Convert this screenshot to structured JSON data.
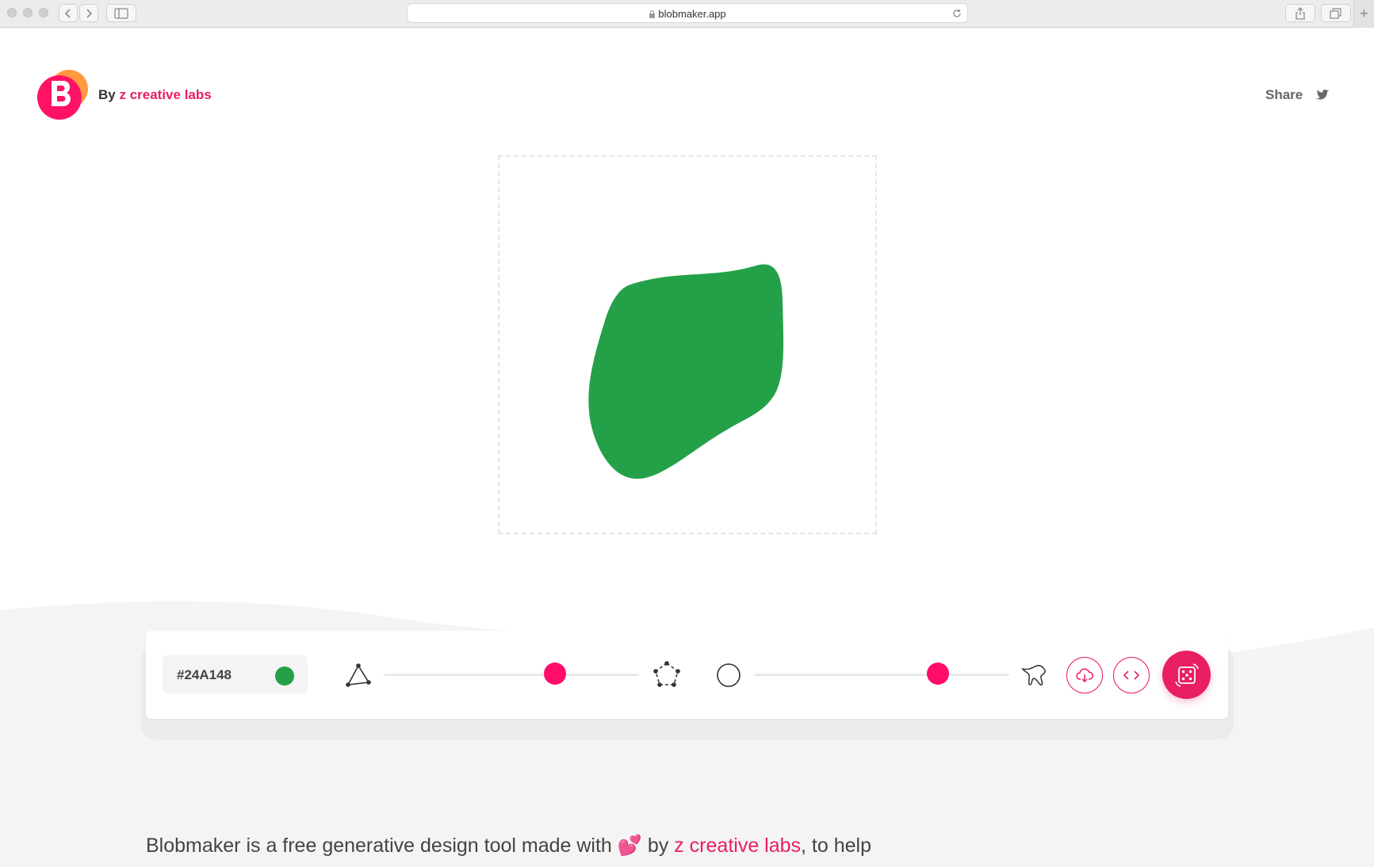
{
  "browser": {
    "url": "blobmaker.app"
  },
  "header": {
    "by_label": "By",
    "brand_name": "z creative labs",
    "share_label": "Share"
  },
  "controls": {
    "color_hex": "#24A148",
    "color_value": "#24A148",
    "complexity_value": 0.67,
    "contrast_value": 0.72
  },
  "description": {
    "prefix": "Blobmaker is a free generative design tool made with",
    "emoji": "💕",
    "by": "by",
    "link": "z creative labs",
    "suffix": ", to help"
  },
  "colors": {
    "accent": "#e91e63",
    "blob": "#24A148"
  }
}
